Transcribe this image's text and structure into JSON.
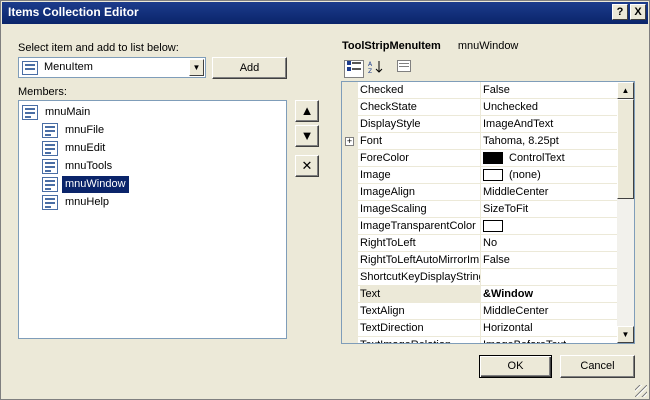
{
  "window": {
    "title": "Items Collection Editor",
    "help_label": "?",
    "close_label": "X"
  },
  "select": {
    "label": "Select item and add to list below:",
    "value": "MenuItem",
    "add_label": "Add"
  },
  "members": {
    "label": "Members:",
    "root": "mnuMain",
    "children": [
      "mnuFile",
      "mnuEdit",
      "mnuTools",
      "mnuWindow",
      "mnuHelp"
    ],
    "selected": "mnuWindow"
  },
  "side_buttons": {
    "up": "▲",
    "down": "▼",
    "delete": "✕"
  },
  "properties": {
    "type_name": "ToolStripMenuItem",
    "object_name": "mnuWindow",
    "rows": [
      {
        "name": "Checked",
        "value": "False"
      },
      {
        "name": "CheckState",
        "value": "Unchecked"
      },
      {
        "name": "DisplayStyle",
        "value": "ImageAndText"
      },
      {
        "name": "Font",
        "value": "Tahoma, 8.25pt",
        "expand": "+"
      },
      {
        "name": "ForeColor",
        "value": "ControlText",
        "swatch": "#000000"
      },
      {
        "name": "Image",
        "value": "(none)",
        "swatch": "#ffffff"
      },
      {
        "name": "ImageAlign",
        "value": "MiddleCenter"
      },
      {
        "name": "ImageScaling",
        "value": "SizeToFit"
      },
      {
        "name": "ImageTransparentColor",
        "value": "",
        "swatch": "#ffffff"
      },
      {
        "name": "RightToLeft",
        "value": "No"
      },
      {
        "name": "RightToLeftAutoMirrorIm",
        "value": "False"
      },
      {
        "name": "ShortcutKeyDisplayString",
        "value": ""
      },
      {
        "name": "Text",
        "value": "&Window",
        "highlight": true
      },
      {
        "name": "TextAlign",
        "value": "MiddleCenter"
      },
      {
        "name": "TextDirection",
        "value": "Horizontal"
      },
      {
        "name": "TextImageRelation",
        "value": "ImageBeforeText"
      }
    ]
  },
  "footer": {
    "ok_label": "OK",
    "cancel_label": "Cancel"
  },
  "colors": {
    "titlebar": "#0a246a",
    "face": "#ece9d8",
    "selection": "#0a246a"
  }
}
